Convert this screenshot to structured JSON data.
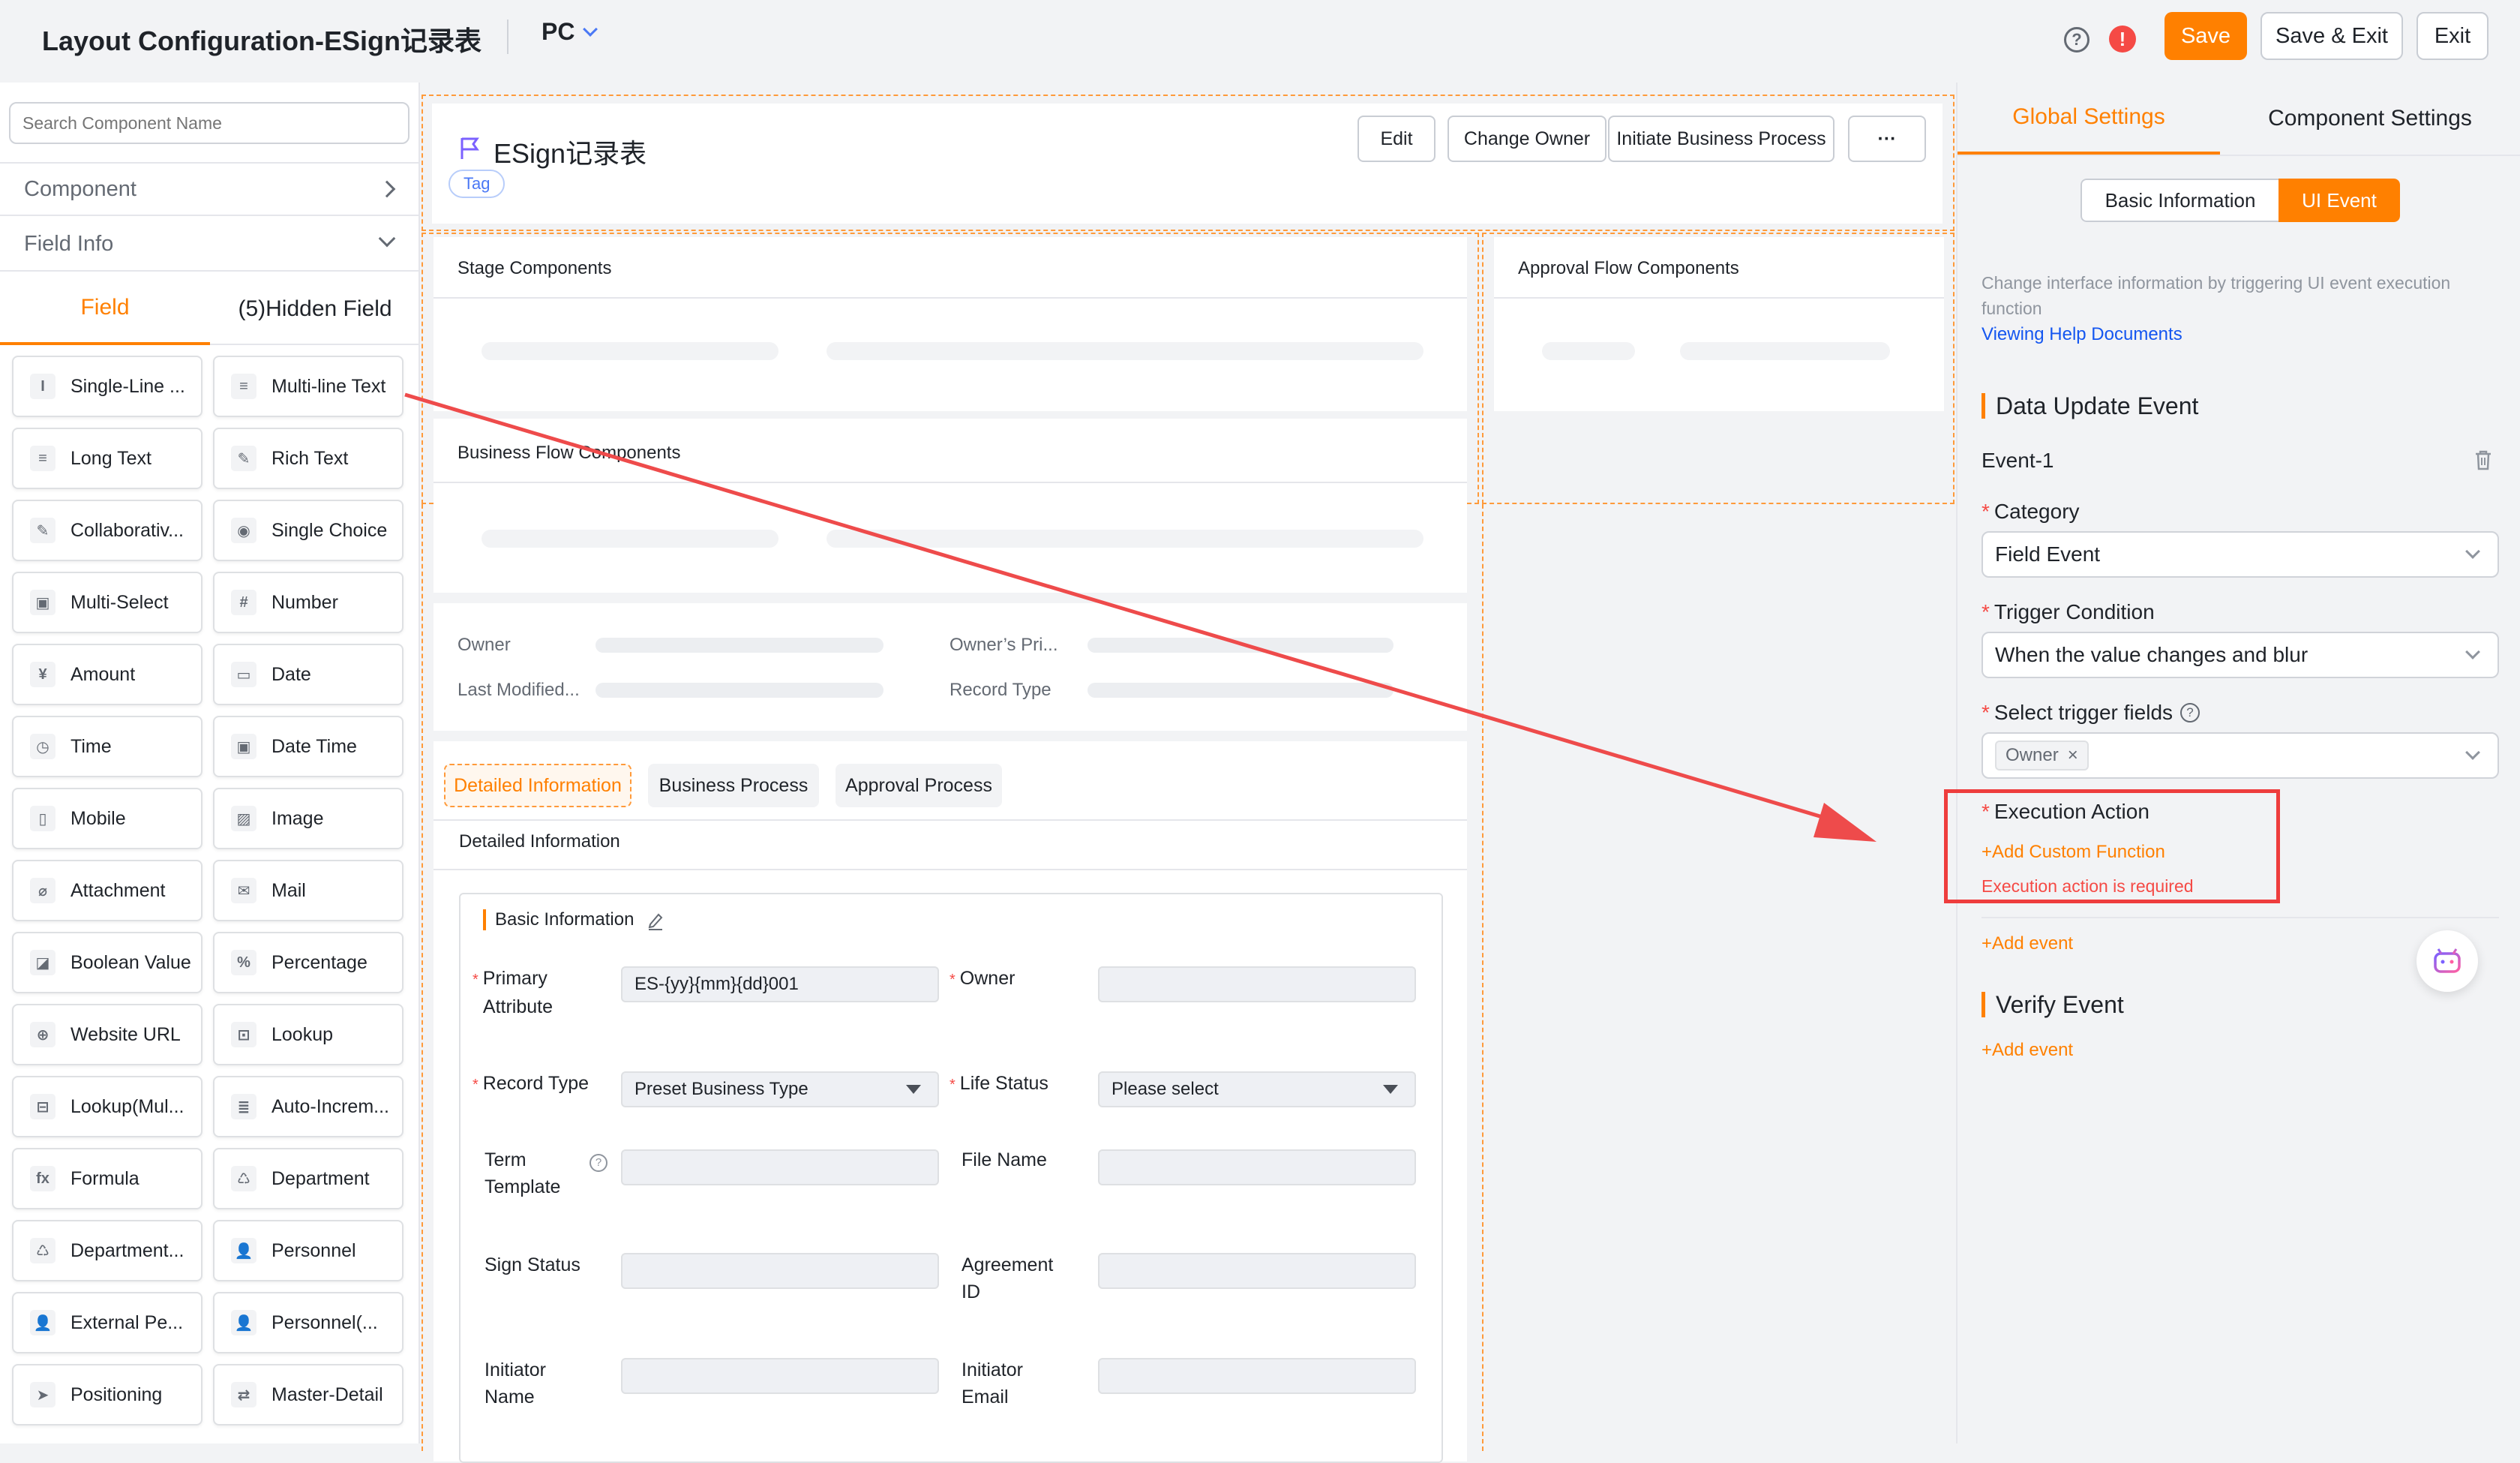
{
  "topbar": {
    "title": "Layout Configuration-ESign记录表",
    "device": "PC",
    "help_icon": "?",
    "warn_icon": "!",
    "save_label": "Save",
    "save_exit_label": "Save & Exit",
    "exit_label": "Exit"
  },
  "left": {
    "search_placeholder": "Search Component Name",
    "component_label": "Component",
    "field_info_label": "Field Info",
    "tabs": [
      "Field",
      "(5)Hidden Field"
    ],
    "fields": [
      {
        "label": "Single-Line ...",
        "icon": "I"
      },
      {
        "label": "Multi-line Text",
        "icon": "≡"
      },
      {
        "label": "Long Text",
        "icon": "≡"
      },
      {
        "label": "Rich Text",
        "icon": "✎"
      },
      {
        "label": "Collaborativ...",
        "icon": "✎"
      },
      {
        "label": "Single Choice",
        "icon": "◉"
      },
      {
        "label": "Multi-Select",
        "icon": "▣"
      },
      {
        "label": "Number",
        "icon": "#"
      },
      {
        "label": "Amount",
        "icon": "¥"
      },
      {
        "label": "Date",
        "icon": "▭"
      },
      {
        "label": "Time",
        "icon": "◷"
      },
      {
        "label": "Date Time",
        "icon": "▣"
      },
      {
        "label": "Mobile",
        "icon": "▯"
      },
      {
        "label": "Image",
        "icon": "▨"
      },
      {
        "label": "Attachment",
        "icon": "⌀"
      },
      {
        "label": "Mail",
        "icon": "✉"
      },
      {
        "label": "Boolean Value",
        "icon": "◪"
      },
      {
        "label": "Percentage",
        "icon": "%"
      },
      {
        "label": "Website URL",
        "icon": "⊕"
      },
      {
        "label": "Lookup",
        "icon": "⊡"
      },
      {
        "label": "Lookup(Mul...",
        "icon": "⊟"
      },
      {
        "label": "Auto-Increm...",
        "icon": "≣"
      },
      {
        "label": "Formula",
        "icon": "fx"
      },
      {
        "label": "Department",
        "icon": "♺"
      },
      {
        "label": "Department...",
        "icon": "♺"
      },
      {
        "label": "Personnel",
        "icon": "👤"
      },
      {
        "label": "External Pe...",
        "icon": "👤"
      },
      {
        "label": "Personnel(...",
        "icon": "👤"
      },
      {
        "label": "Positioning",
        "icon": "➤"
      },
      {
        "label": "Master-Detail",
        "icon": "⇄"
      }
    ]
  },
  "canvas": {
    "header_title": "ESign记录表",
    "tag_label": "Tag",
    "buttons": [
      "Edit",
      "Change Owner",
      "Initiate Business Process",
      "···"
    ],
    "stage_title": "Stage Components",
    "approval_title": "Approval Flow Components",
    "business_flow_title": "Business Flow Components",
    "summary": {
      "owner": "Owner",
      "owner_pri": "Owner’s Pri...",
      "last_modified": "Last Modified...",
      "record_type": "Record Type"
    },
    "sub_tabs": [
      "Detailed Information",
      "Business Process",
      "Approval Process"
    ],
    "detail_header": "Detailed Information",
    "basic_info_title": "Basic Information",
    "form": {
      "primary_attr_l1": "Primary",
      "primary_attr_l2": "Attribute",
      "primary_attr_value": "ES-{yy}{mm}{dd}001",
      "owner": "Owner",
      "record_type": "Record Type",
      "record_type_value": "Preset Business Type",
      "life_status": "Life Status",
      "life_status_value": "Please select",
      "term_l1": "Term",
      "term_l2": "Template",
      "file_name": "File Name",
      "sign_status": "Sign Status",
      "agreement_l1": "Agreement",
      "agreement_l2": "ID",
      "initiator_name_l1": "Initiator",
      "initiator_name_l2": "Name",
      "initiator_email_l1": "Initiator",
      "initiator_email_l2": "Email"
    }
  },
  "right": {
    "tabs": [
      "Global Settings",
      "Component Settings"
    ],
    "seg": [
      "Basic Information",
      "UI Event"
    ],
    "description": "Change interface information by triggering UI event execution function",
    "help_link": "Viewing Help Documents",
    "data_update_title": "Data Update Event",
    "event_name": "Event-1",
    "category_label": "Category",
    "category_value": "Field Event",
    "trigger_label": "Trigger Condition",
    "trigger_value": "When the value changes and blur",
    "select_fields_label": "Select trigger fields",
    "owner_tag": "Owner",
    "execution_label": "Execution Action",
    "add_custom_function": "+Add Custom Function",
    "execution_error": "Execution action is required",
    "add_event": "+Add event",
    "verify_title": "Verify Event",
    "add_event_2": "+Add event"
  },
  "colors": {
    "accent": "#ff8000",
    "link": "#1456f0",
    "error": "#f54a45",
    "annotation": "#ee3d3d"
  }
}
